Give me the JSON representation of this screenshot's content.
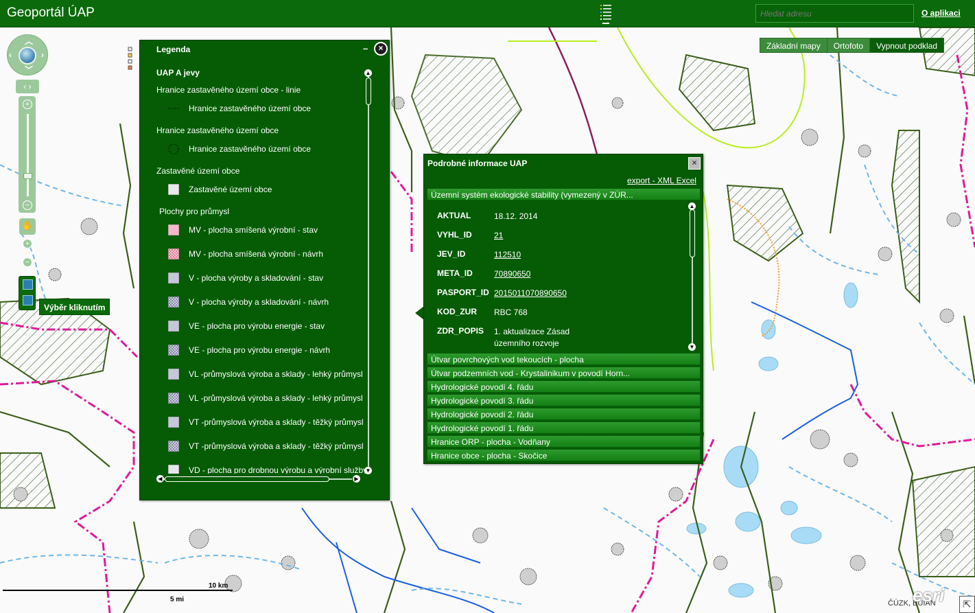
{
  "header": {
    "title": "Geoportál ÚAP",
    "search_placeholder": "Hledat adresu",
    "about_link": "O aplikaci"
  },
  "basemap": {
    "buttons": [
      "Základní mapy",
      "Ortofoto",
      "Vypnout podklad"
    ]
  },
  "map_controls": {
    "select_tooltip": "Výběr kliknutím"
  },
  "legend": {
    "title": "Legenda",
    "minimize_symbol": "–",
    "close_symbol": "×",
    "layer_name": "UAP A jevy",
    "groups": [
      {
        "heading": "Hranice zastavěného území obce - linie",
        "items": [
          {
            "label": "Hranice zastavěného území obce",
            "symbol": "dotted-line"
          }
        ]
      },
      {
        "heading": "Hranice zastavěného území obce",
        "items": [
          {
            "label": "Hranice zastavěného území obce",
            "symbol": "dotted-circle"
          }
        ]
      },
      {
        "heading": "Zastavěné území obce",
        "items": [
          {
            "label": "Zastavěné území obce",
            "symbol": "light-gray-fill"
          }
        ]
      },
      {
        "heading": "Plochy pro průmysl",
        "items": [
          {
            "label": "MV - plocha smíšená výrobní - stav",
            "symbol": "pink-fill"
          },
          {
            "label": "MV - plocha smíšená výrobní - návrh",
            "symbol": "pink-hatch"
          },
          {
            "label": "V - plocha výroby a skladování - stav",
            "symbol": "gray-blue-fill"
          },
          {
            "label": "V - plocha výroby a skladování - návrh",
            "symbol": "gray-blue-hatch"
          },
          {
            "label": "VE - plocha pro výrobu energie - stav",
            "symbol": "gray-blue-fill"
          },
          {
            "label": "VE - plocha pro výrobu energie - návrh",
            "symbol": "gray-blue-hatch"
          },
          {
            "label": "VL -průmyslová výroba a sklady - lehký průmysl",
            "symbol": "gray-blue-fill"
          },
          {
            "label": "VL -průmyslová výroba a sklady - lehký průmysl",
            "symbol": "gray-blue-hatch"
          },
          {
            "label": "VT -průmyslová výroba a sklady - těžký průmysl",
            "symbol": "gray-blue-fill"
          },
          {
            "label": "VT -průmyslová výroba a sklady - těžký průmysl",
            "symbol": "gray-blue-hatch"
          },
          {
            "label": "VD - plocha pro drobnou výrobu a výrobní služby",
            "symbol": "light-gray-fill"
          }
        ]
      }
    ]
  },
  "info_popup": {
    "title": "Podrobné informace UAP",
    "close_symbol": "×",
    "export_label": "export - XML Excel",
    "expanded_section": "Územní systém ekologické stability (vymezený v ZÚR...",
    "attributes": [
      {
        "key": "AKTUAL",
        "value": "18.12. 2014",
        "link": false
      },
      {
        "key": "VYHL_ID",
        "value": "21",
        "link": true
      },
      {
        "key": "JEV_ID",
        "value": "112510",
        "link": true
      },
      {
        "key": "META_ID",
        "value": "70890650",
        "link": true
      },
      {
        "key": "PASPORT_ID",
        "value": "2015011070890650",
        "link": true
      },
      {
        "key": "KOD_ZUR",
        "value": "RBC 768",
        "link": false
      },
      {
        "key": "ZDR_POPIS",
        "value": "1. aktualizace Zásad územního rozvoje",
        "link": false
      }
    ],
    "sections": [
      "Útvar povrchových vod tekoucích - plocha",
      "Útvar podzemních vod - Krystalinikum v povodí Horn...",
      "Hydrologické povodí 4. řádu",
      "Hydrologické povodí 3. řádu",
      "Hydrologické povodí 2. řádu",
      "Hydrologické povodí 1. řádu",
      "Hranice ORP - plocha - Vodňany",
      "Hranice obce - plocha - Skočice"
    ]
  },
  "scale": {
    "km_label": "10 km",
    "mi_label": "5 mi"
  },
  "attribution": {
    "text": "ČÚZK, BÚIAN",
    "esri": "esri"
  },
  "colors": {
    "header_bg": "#0b6a0b",
    "panel_bg": "#055c05",
    "section_bg": "#148014",
    "boundary_magenta": "#e0199a",
    "water_blue": "#1a5fe0",
    "water_light": "#a8dcf6",
    "green_boundary": "#3b5e1a",
    "lime_line": "#b8ee20"
  }
}
